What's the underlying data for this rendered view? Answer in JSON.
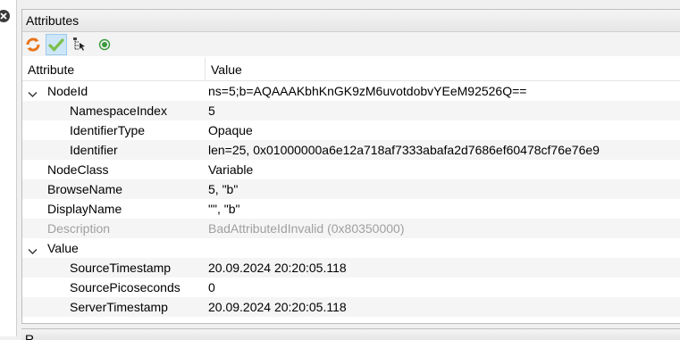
{
  "panel": {
    "title": "Attributes"
  },
  "toolbar": {
    "buttons": [
      {
        "icon": "refresh-icon"
      },
      {
        "icon": "check-icon",
        "active": true
      },
      {
        "icon": "tree-select-icon"
      },
      {
        "icon": "radio-target-icon"
      }
    ]
  },
  "grid": {
    "columns": {
      "attribute": "Attribute",
      "value": "Value"
    },
    "rows": [
      {
        "name": "NodeId",
        "value": "ns=5;b=AQAAAKbhKnGK9zM6uvotdobvYEeM92526Q==",
        "level": 0,
        "expand": "expanded"
      },
      {
        "name": "NamespaceIndex",
        "value": "5",
        "level": 1
      },
      {
        "name": "IdentifierType",
        "value": "Opaque",
        "level": 1
      },
      {
        "name": "Identifier",
        "value": "len=25, 0x01000000a6e12a718af7333abafa2d7686ef60478cf76e76e9",
        "level": 1
      },
      {
        "name": "NodeClass",
        "value": "Variable",
        "level": 0
      },
      {
        "name": "BrowseName",
        "value": "5, \"b\"",
        "level": 0
      },
      {
        "name": "DisplayName",
        "value": "\"\", \"b\"",
        "level": 0
      },
      {
        "name": "Description",
        "value": "BadAttributeIdInvalid (0x80350000)",
        "level": 0,
        "dim": true
      },
      {
        "name": "Value",
        "value": "",
        "level": 0,
        "expand": "expanded"
      },
      {
        "name": "SourceTimestamp",
        "value": "20.09.2024 20:20:05.118",
        "level": 1
      },
      {
        "name": "SourcePicoseconds",
        "value": "0",
        "level": 1
      },
      {
        "name": "ServerTimestamp",
        "value": "20.09.2024 20:20:05.118",
        "level": 1
      }
    ]
  },
  "bottom_panel": {
    "title": "R..."
  }
}
